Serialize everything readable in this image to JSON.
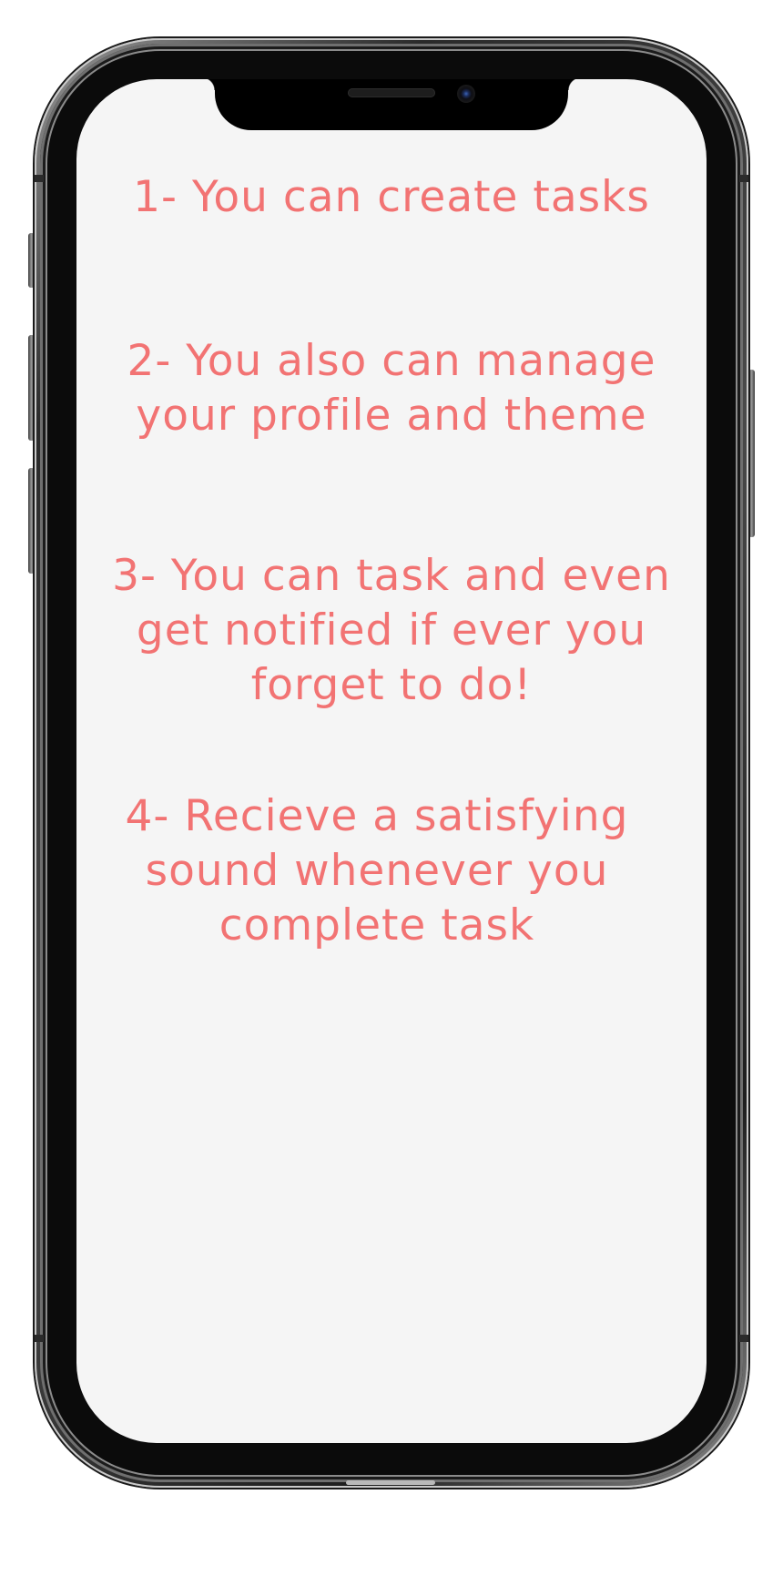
{
  "onboarding": {
    "features": [
      {
        "lines": [
          "1- You can create tasks"
        ]
      },
      {
        "lines": [
          "2- You also can manage",
          "your profile and theme"
        ]
      },
      {
        "lines": [
          "3- You can task and even",
          "get notified if ever you",
          "forget to do!"
        ]
      },
      {
        "lines": [
          "4- Recieve a satisfying",
          "sound whenever you",
          "complete task"
        ]
      }
    ]
  },
  "colors": {
    "text_accent": "#f27373",
    "screen_background": "#f5f5f5",
    "page_background": "#ffffff",
    "device_frame": "#0b0b0b"
  }
}
